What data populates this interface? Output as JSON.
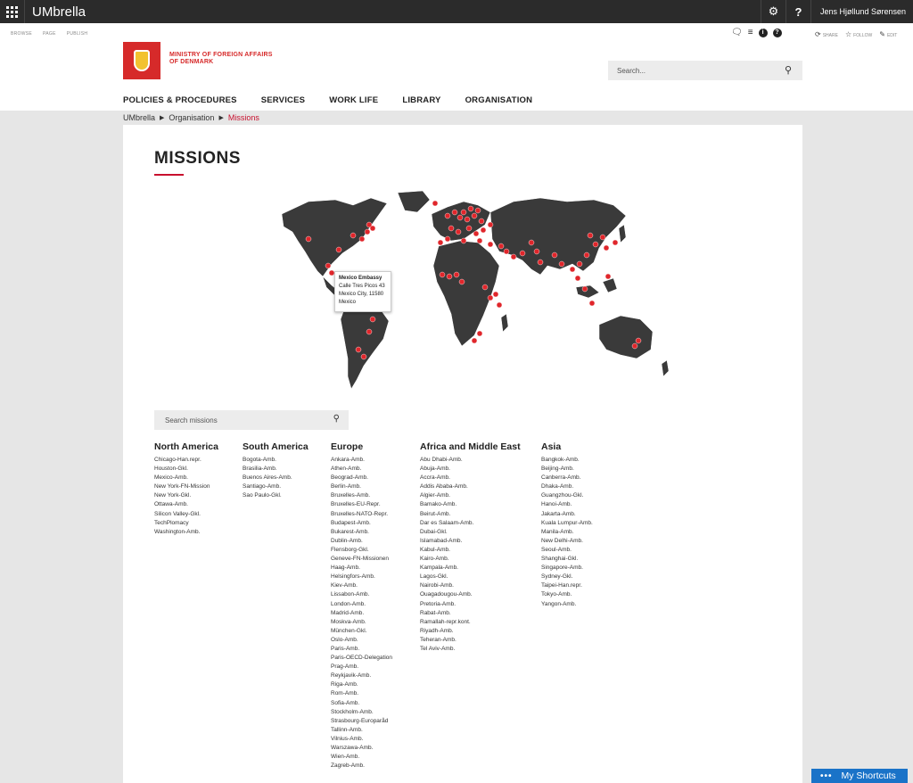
{
  "suitebar": {
    "app_title": "UMbrella",
    "settings_icon": "gear-icon",
    "help_label": "?",
    "user_name": "Jens Hjøllund Sørensen"
  },
  "ribbon": {
    "tabs": [
      "BROWSE",
      "PAGE",
      "PUBLISH"
    ],
    "share_label": "SHARE",
    "follow_label": "FOLLOW",
    "edit_label": "EDIT"
  },
  "header": {
    "logo_line1": "MINISTRY OF FOREIGN AFFAIRS",
    "logo_line2": "OF DENMARK",
    "search_placeholder": "Search...",
    "nav": [
      "POLICIES & PROCEDURES",
      "SERVICES",
      "WORK LIFE",
      "LIBRARY",
      "ORGANISATION"
    ]
  },
  "breadcrumb": [
    "UMbrella",
    "Organisation",
    "Missions"
  ],
  "page": {
    "title": "MISSIONS",
    "map_tooltip": {
      "title": "Mexico Embassy",
      "line1": "Calle Tres Picos 43",
      "line2": "Mexico City, 11580",
      "line3": "Mexico"
    },
    "search_placeholder": "Search missions"
  },
  "regions": [
    {
      "name": "North America",
      "items": [
        "Chicago-Han.repr.",
        "Houston-Gkl.",
        "Mexico-Amb.",
        "New York-FN-Mission",
        "New York-Gkl.",
        "Ottawa-Amb.",
        "Silicon Valley-Gkl.",
        "TechPlomacy",
        "Washington-Amb."
      ]
    },
    {
      "name": "South America",
      "items": [
        "Bogota-Amb.",
        "Brasilia-Amb.",
        "Buenos Aires-Amb.",
        "Santiago-Amb.",
        "Sao Paulo-Gkl."
      ]
    },
    {
      "name": "Europe",
      "items": [
        "Ankara-Amb.",
        "Athen-Amb.",
        "Beograd-Amb.",
        "Berlin-Amb.",
        "Bruxelles-Amb.",
        "Bruxelles-EU-Repr.",
        "Bruxelles-NATO-Repr.",
        "Budapest-Amb.",
        "Bukarest-Amb.",
        "Dublin-Amb.",
        "Flensborg-Gkl.",
        "Geneve-FN-Missionen",
        "Haag-Amb.",
        "Helsingfors-Amb.",
        "Kiev-Amb.",
        "Lissabon-Amb.",
        "London-Amb.",
        "Madrid-Amb.",
        "Moskva-Amb.",
        "München-Gkl.",
        "Oslo-Amb.",
        "Paris-Amb.",
        "Paris-OECD-Delegation",
        "Prag-Amb.",
        "Reykjavik-Amb.",
        "Riga-Amb.",
        "Rom-Amb.",
        "Sofia-Amb.",
        "Stockholm-Amb.",
        "Strasbourg-Europaråd",
        "Tallinn-Amb.",
        "Vilnius-Amb.",
        "Warszawa-Amb.",
        "Wien-Amb.",
        "Zagreb-Amb."
      ]
    },
    {
      "name": "Africa and Middle East",
      "items": [
        "Abu Dhabi-Amb.",
        "Abuja-Amb.",
        "Accra-Amb.",
        "Addis Ababa-Amb.",
        "Algier-Amb.",
        "Bamako-Amb.",
        "Beirut-Amb.",
        "Dar es Salaam-Amb.",
        "Dubai-Gkl.",
        "Islamabad-Amb.",
        "Kabul-Amb.",
        "Kairo-Amb.",
        "Kampala-Amb.",
        "Lagos-Gkl.",
        "Nairobi-Amb.",
        "Ouagadougou-Amb.",
        "Pretoria-Amb.",
        "Rabat-Amb.",
        "Ramallah-repr.kont.",
        "Riyadh-Amb.",
        "Teheran-Amb.",
        "Tel Aviv-Amb."
      ]
    },
    {
      "name": "Asia",
      "items": [
        "Bangkok-Amb.",
        "Beijing-Amb.",
        "Canberra-Amb.",
        "Dhaka-Amb.",
        "Guangzhou-Gkl.",
        "Hanoi-Amb.",
        "Jakarta-Amb.",
        "Kuala Lumpur-Amb.",
        "Manila-Amb.",
        "New Delhi-Amb.",
        "Seoul-Amb.",
        "Shanghai-Gkl.",
        "Singapore-Amb.",
        "Sydney-Gkl.",
        "Taipei-Han.repr.",
        "Tokyo-Amb.",
        "Yangon-Amb."
      ]
    }
  ],
  "footer": {
    "shortcuts_label": "My Shortcuts"
  },
  "colors": {
    "accent_red": "#c8102e",
    "map_land": "#3a3a3a",
    "pin": "#e0262b",
    "shortcut_blue": "#1a73c8"
  }
}
